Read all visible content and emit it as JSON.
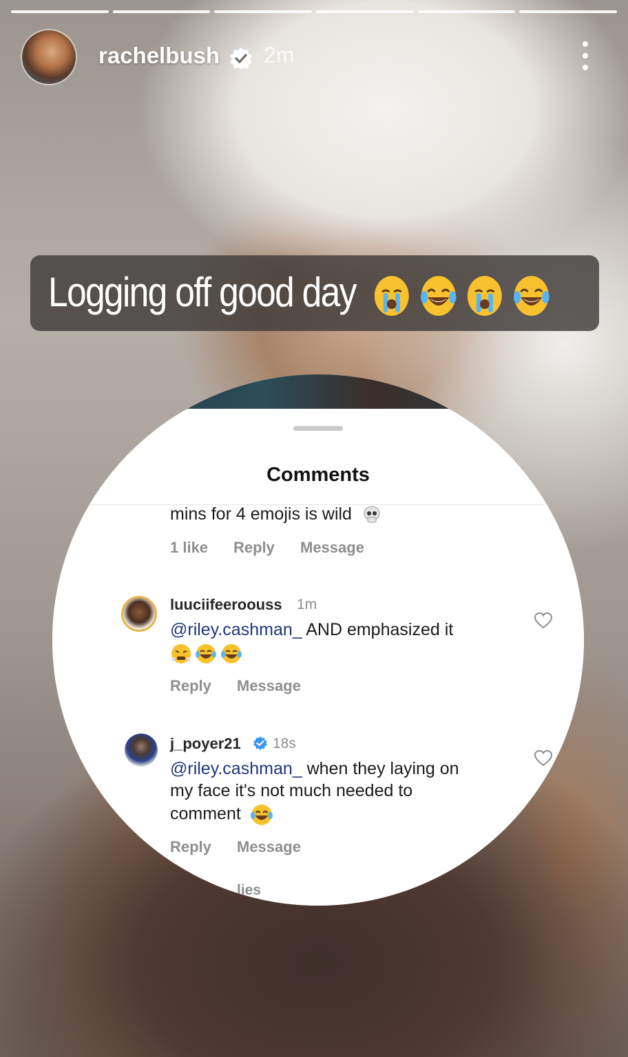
{
  "story": {
    "username": "rachelbush",
    "time": "2m",
    "caption": "Logging off good day",
    "caption_emojis": [
      "crying-face",
      "tears-of-joy",
      "crying-face",
      "tears-of-joy"
    ],
    "progress_segments": 6
  },
  "comments_sheet": {
    "title": "Comments",
    "partial_comment": {
      "text": "mins for 4 emojis is wild",
      "emoji": "skull",
      "likes": "1 like",
      "reply": "Reply",
      "message": "Message"
    },
    "comments": [
      {
        "username": "luuciifeeroouss",
        "time": "1m",
        "mention": "@riley.cashman_",
        "text": " AND emphasized it",
        "emojis": [
          "steam-face",
          "tears-of-joy",
          "tears-of-joy"
        ],
        "reply": "Reply",
        "message": "Message"
      },
      {
        "username": "j_poyer21",
        "verified": true,
        "time": "18s",
        "mention": "@riley.cashman_",
        "line1": " when they laying on",
        "line2": "my face it's not much needed to",
        "line3": "comment",
        "emoji": "tears-of-joy",
        "reply": "Reply",
        "message": "Message"
      }
    ],
    "cut_off_text": "lies"
  },
  "colors": {
    "mention": "#20367a",
    "verified_blue": "#3797f0",
    "meta_gray": "#8e8e8e"
  }
}
